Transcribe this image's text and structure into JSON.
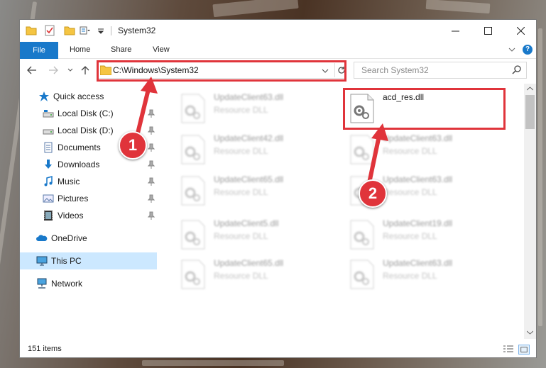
{
  "window": {
    "title": "System32",
    "controls": {
      "minimize": "—",
      "maximize": "☐",
      "close": "✕"
    }
  },
  "ribbon": {
    "tabs": [
      {
        "label": "File"
      },
      {
        "label": "Home"
      },
      {
        "label": "Share"
      },
      {
        "label": "View"
      }
    ]
  },
  "navbar": {
    "address": "C:\\Windows\\System32",
    "search_placeholder": "Search System32"
  },
  "sidebar": {
    "items": [
      {
        "label": "Quick access",
        "icon": "star-icon",
        "pinned": false
      },
      {
        "label": "Local Disk (C:)",
        "icon": "drive-icon",
        "pinned": true
      },
      {
        "label": "Local Disk (D:)",
        "icon": "drive-icon",
        "pinned": true
      },
      {
        "label": "Documents",
        "icon": "documents-icon",
        "pinned": true
      },
      {
        "label": "Downloads",
        "icon": "downloads-icon",
        "pinned": true
      },
      {
        "label": "Music",
        "icon": "music-icon",
        "pinned": true
      },
      {
        "label": "Pictures",
        "icon": "pictures-icon",
        "pinned": true
      },
      {
        "label": "Videos",
        "icon": "videos-icon",
        "pinned": true
      },
      {
        "label": "OneDrive",
        "icon": "cloud-icon",
        "pinned": false
      },
      {
        "label": "This PC",
        "icon": "computer-icon",
        "pinned": false,
        "selected": true
      },
      {
        "label": "Network",
        "icon": "network-icon",
        "pinned": false
      }
    ]
  },
  "files": [
    {
      "name": "UpdateClient63.dll",
      "type": "Resource DLL",
      "blurred": true
    },
    {
      "name": "acd_res.dll",
      "type": "",
      "blurred": false
    },
    {
      "name": "UpdateClient42.dll",
      "type": "Resource DLL",
      "blurred": true
    },
    {
      "name": "UpdateClient63.dll",
      "type": "Resource DLL",
      "blurred": true
    },
    {
      "name": "UpdateClient65.dll",
      "type": "Resource DLL",
      "blurred": true
    },
    {
      "name": "UpdateClient63.dll",
      "type": "Resource DLL",
      "blurred": true
    },
    {
      "name": "UpdateClient5.dll",
      "type": "Resource DLL",
      "blurred": true
    },
    {
      "name": "UpdateClient19.dll",
      "type": "Resource DLL",
      "blurred": true
    },
    {
      "name": "UpdateClient65.dll",
      "type": "Resource DLL",
      "blurred": true
    },
    {
      "name": "UpdateClient63.dll",
      "type": "Resource DLL",
      "blurred": true
    }
  ],
  "status": {
    "item_count": "151 items"
  },
  "callouts": [
    {
      "label": "1"
    },
    {
      "label": "2"
    }
  ],
  "colors": {
    "accent": "#1979ca",
    "highlight": "#e0343b",
    "selected": "#cce8ff"
  }
}
